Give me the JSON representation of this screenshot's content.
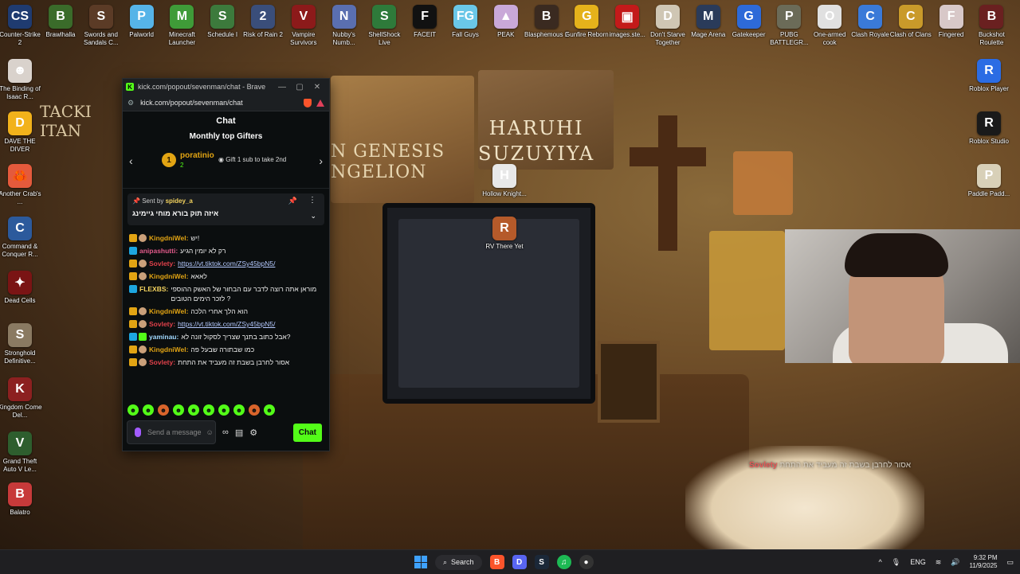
{
  "desktop": {
    "left_icons": [
      {
        "label": "Counter-Strike 2",
        "color": "#1f3b70",
        "glyph": "CS"
      },
      {
        "label": "The Binding of Isaac R...",
        "color": "#d9d2cc",
        "glyph": "☻"
      },
      {
        "label": "DAVE THE DIVER",
        "color": "#f2b21b",
        "glyph": "D"
      },
      {
        "label": "Another Crab's ...",
        "color": "#e45a3c",
        "glyph": "🦀"
      },
      {
        "label": "Command & Conquer R...",
        "color": "#2c5a9c",
        "glyph": "C"
      },
      {
        "label": "Dead Cells",
        "color": "#7a1414",
        "glyph": "✦"
      },
      {
        "label": "Stronghold Definitive...",
        "color": "#8a7a62",
        "glyph": "S"
      },
      {
        "label": "Kingdom Come Del...",
        "color": "#8c2020",
        "glyph": "K"
      },
      {
        "label": "Grand Theft Auto V Le...",
        "color": "#2e5e2e",
        "glyph": "V"
      },
      {
        "label": "Balatro",
        "color": "#c73a3a",
        "glyph": "B"
      }
    ],
    "top_icons": [
      {
        "label": "Brawlhalla",
        "color": "#3a6b2a",
        "glyph": "B"
      },
      {
        "label": "Swords and Sandals C...",
        "color": "#5b3b26",
        "glyph": "S"
      },
      {
        "label": "Palworld",
        "color": "#56b4e8",
        "glyph": "P"
      },
      {
        "label": "Minecraft Launcher",
        "color": "#3f9b38",
        "glyph": "M"
      },
      {
        "label": "Schedule I",
        "color": "#3c7a3c",
        "glyph": "S"
      },
      {
        "label": "Risk of Rain 2",
        "color": "#3a4e7a",
        "glyph": "2"
      },
      {
        "label": "Vampire Survivors",
        "color": "#8c1a1a",
        "glyph": "V"
      },
      {
        "label": "Nubby's Numb...",
        "color": "#5a6fb0",
        "glyph": "N"
      },
      {
        "label": "ShellShock Live",
        "color": "#2e7a3a",
        "glyph": "S"
      },
      {
        "label": "FACEIT",
        "color": "#111111",
        "glyph": "F"
      },
      {
        "label": "Fall Guys",
        "color": "#6ac7e8",
        "glyph": "FG"
      },
      {
        "label": "PEAK",
        "color": "#c9a8d8",
        "glyph": "▲"
      },
      {
        "label": "Blasphemous 2",
        "color": "#3a2a20",
        "glyph": "B"
      },
      {
        "label": "Gunfire Reborn",
        "color": "#e5b21b",
        "glyph": "G"
      },
      {
        "label": "images.ste...",
        "color": "#c31a1a",
        "glyph": "▣"
      },
      {
        "label": "Don't Starve Together",
        "color": "#cfc6b4",
        "glyph": "D"
      },
      {
        "label": "Mage Arena",
        "color": "#2a3b5a",
        "glyph": "M"
      },
      {
        "label": "Gatekeeper",
        "color": "#2d6ad8",
        "glyph": "G"
      },
      {
        "label": "PUBG BATTLEGR...",
        "color": "#6b6b58",
        "glyph": "P"
      },
      {
        "label": "One-armed cook",
        "color": "#e0e0e0",
        "glyph": "O"
      },
      {
        "label": "Clash Royale",
        "color": "#3a7ad8",
        "glyph": "C"
      },
      {
        "label": "Clash of Clans",
        "color": "#c99a2a",
        "glyph": "C"
      },
      {
        "label": "Fingered",
        "color": "#d8c8c8",
        "glyph": "F"
      },
      {
        "label": "Buckshot Roulette",
        "color": "#6a2020",
        "glyph": "B"
      }
    ],
    "right_icons": [
      {
        "label": "Roblox Player",
        "color": "#2b6ce4",
        "glyph": "R"
      },
      {
        "label": "Roblox Studio",
        "color": "#1a1a1a",
        "glyph": "R"
      },
      {
        "label": "Paddle Padd...",
        "color": "#d8d0b8",
        "glyph": "P"
      }
    ],
    "middle_icons": [
      {
        "label": "Hollow Knight...",
        "color": "#e8e8e8",
        "glyph": "H"
      },
      {
        "label": "RV There Yet",
        "color": "#b55a2a",
        "glyph": "R"
      }
    ],
    "wallpaper_text": {
      "haruhi": "HARUHI\nSUZUYIYA",
      "genesis": "N GENESIS\nNGELION",
      "titan": "TACKI\nITAN"
    }
  },
  "browser": {
    "title": "kick.com/popout/sevenman/chat - Brave",
    "url": "kick.com/popout/sevenman/chat",
    "chat_title": "Chat",
    "gifters": {
      "title": "Monthly top Gifters",
      "rank": "1",
      "name": "poratinio",
      "count": "2",
      "hint": "Gift 1 sub to take 2nd"
    },
    "pinned": {
      "sent_by_label": "Sent by",
      "sender": "spidey_a",
      "text": "איזה תוק בורא מוחי גיימינג"
    },
    "messages": [
      {
        "user": "KingdniWel",
        "color": "#e2a413",
        "badges": [
          "sub",
          "fc"
        ],
        "text": "יש!"
      },
      {
        "user": "anipashutti",
        "color": "#e05a8a",
        "badges": [
          "og"
        ],
        "text": "רק לא יומין הגיע"
      },
      {
        "user": "Sovlety",
        "color": "#e0404a",
        "badges": [
          "sub",
          "fc"
        ],
        "text": "",
        "link": "https://vt.tiktok.com/ZSy45bpN5/"
      },
      {
        "user": "KingdniWel",
        "color": "#e2a413",
        "badges": [
          "sub",
          "fc"
        ],
        "text": "לאאא"
      },
      {
        "user": "FLEXBS",
        "color": "#f4d35e",
        "badges": [
          "og"
        ],
        "text": "מוראן אתה רוצה לדבר עם הבחור של האשק ההוספי לזכר הימים הטובים ?"
      },
      {
        "user": "KingdniWel",
        "color": "#e2a413",
        "badges": [
          "sub",
          "fc"
        ],
        "text": "הוא הלך אחרי הלכה"
      },
      {
        "user": "Sovlety",
        "color": "#e0404a",
        "badges": [
          "sub",
          "fc"
        ],
        "text": "",
        "link": "https://vt.tiktok.com/ZSy45bpN5/"
      },
      {
        "user": "yaminau",
        "color": "#a0d8ff",
        "badges": [
          "og",
          "gr"
        ],
        "text": "אבל כתוב בתנך שצריך לסקול זונה לא?"
      },
      {
        "user": "KingdniWel",
        "color": "#e2a413",
        "badges": [
          "sub",
          "fc"
        ],
        "text": "כמו שבתורה שבעל פה"
      },
      {
        "user": "Sovlety",
        "color": "#e0404a",
        "badges": [
          "sub",
          "fc"
        ],
        "text": "אסור לחרבן בשבת זה מעביד את התחת"
      }
    ],
    "composer": {
      "placeholder": "Send a message",
      "send": "Chat"
    }
  },
  "overlay": {
    "user": "Sovlety",
    "text": "אסור לחרבן בשבת זה מעביד את התחת"
  },
  "taskbar": {
    "search": "Search",
    "lang": "ENG",
    "time": "9:32 PM",
    "date": "11/9/2025"
  }
}
